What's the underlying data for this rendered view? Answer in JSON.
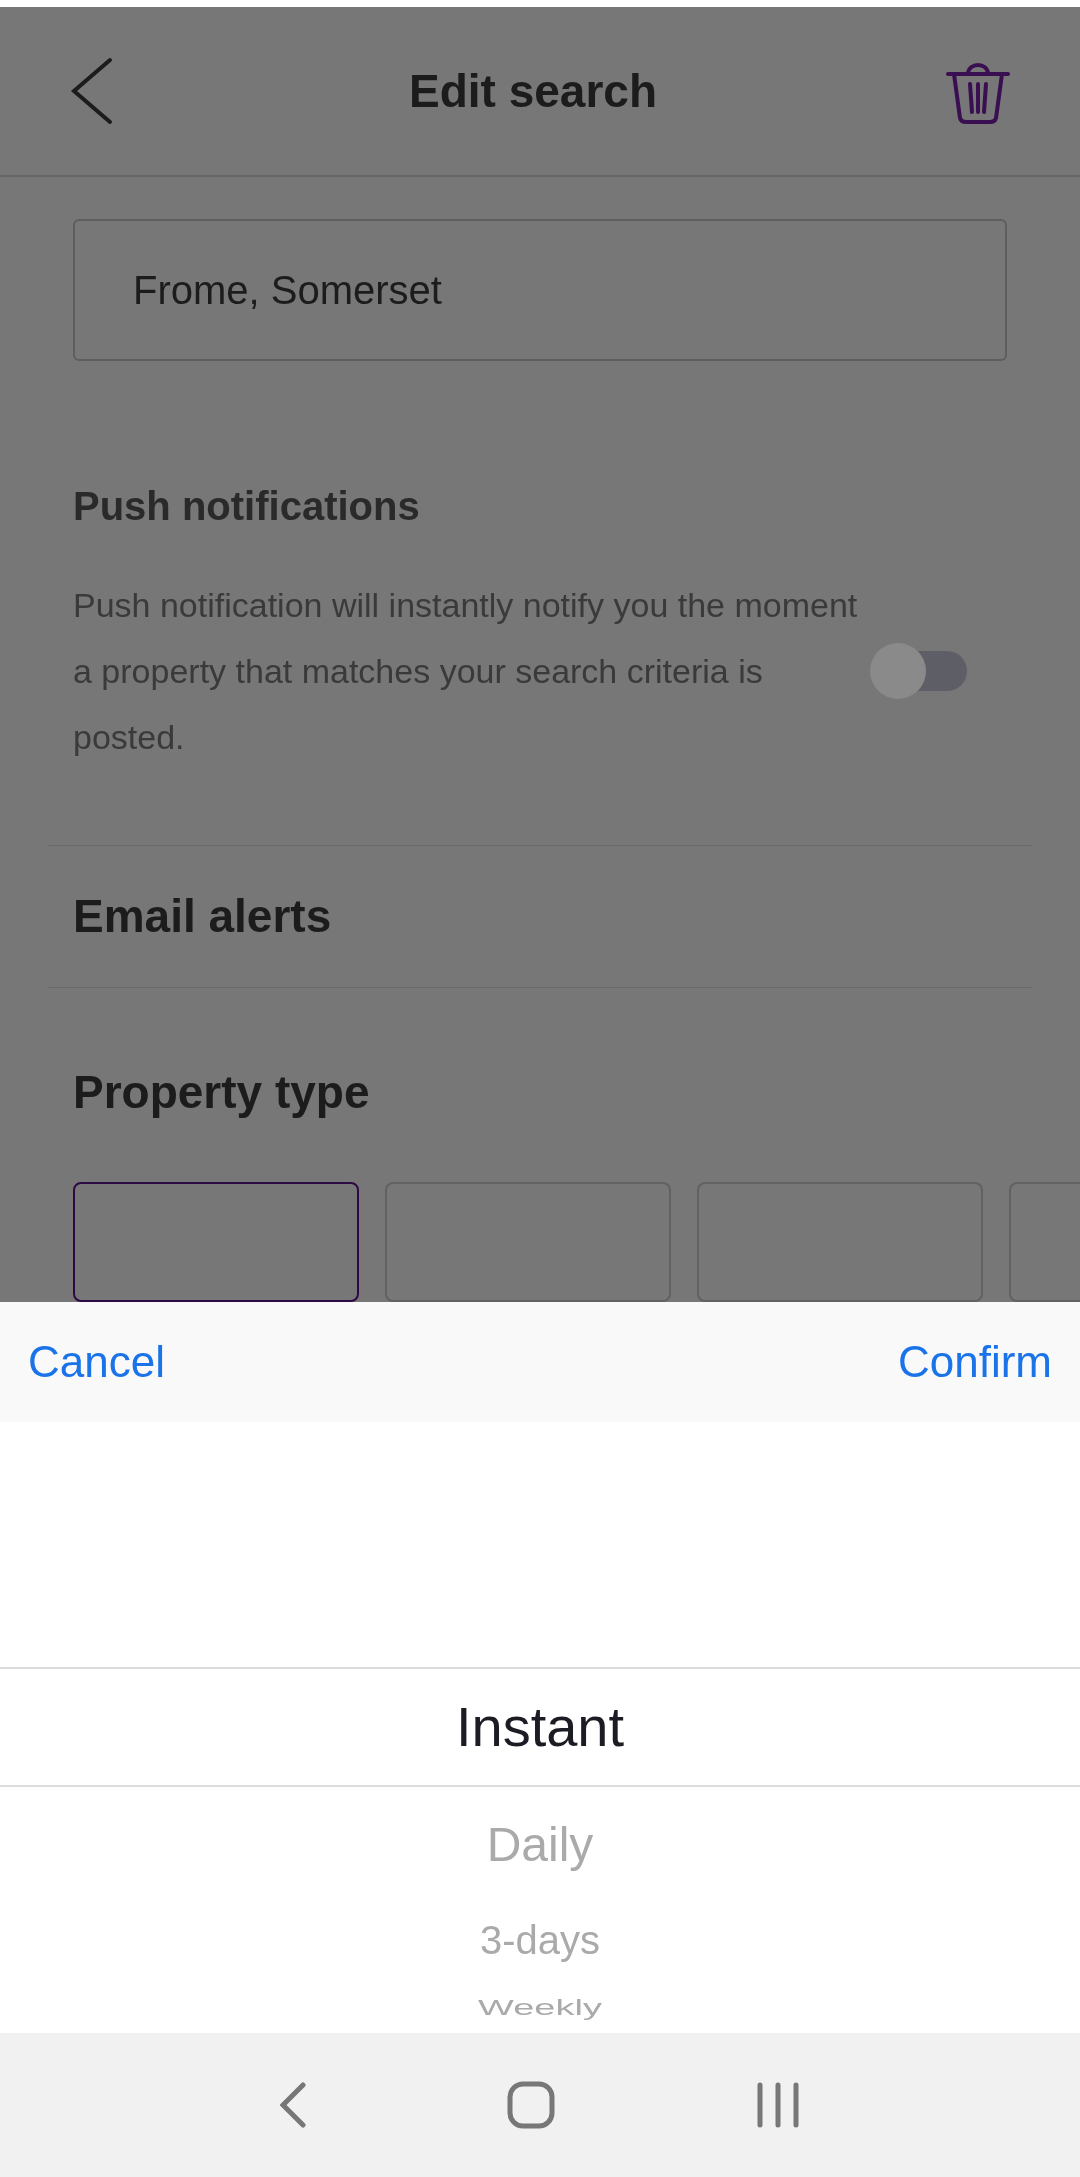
{
  "header": {
    "title": "Edit search"
  },
  "location_field": {
    "value": "Frome, Somerset"
  },
  "push_notifications": {
    "title": "Push notifications",
    "description": "Push notification will instantly notify you the moment a property that matches your search criteria is posted.",
    "on": false
  },
  "email_alerts": {
    "title": "Email alerts"
  },
  "property_type": {
    "title": "Property type",
    "options": [
      {
        "selected": true
      },
      {
        "selected": false
      },
      {
        "selected": false
      },
      {
        "selected": false
      }
    ]
  },
  "picker": {
    "cancel": "Cancel",
    "confirm": "Confirm",
    "options": [
      {
        "label": "Instant",
        "selected": true
      },
      {
        "label": "Daily",
        "selected": false
      },
      {
        "label": "3-days",
        "selected": false
      },
      {
        "label": "Weekly",
        "selected": false
      }
    ]
  }
}
